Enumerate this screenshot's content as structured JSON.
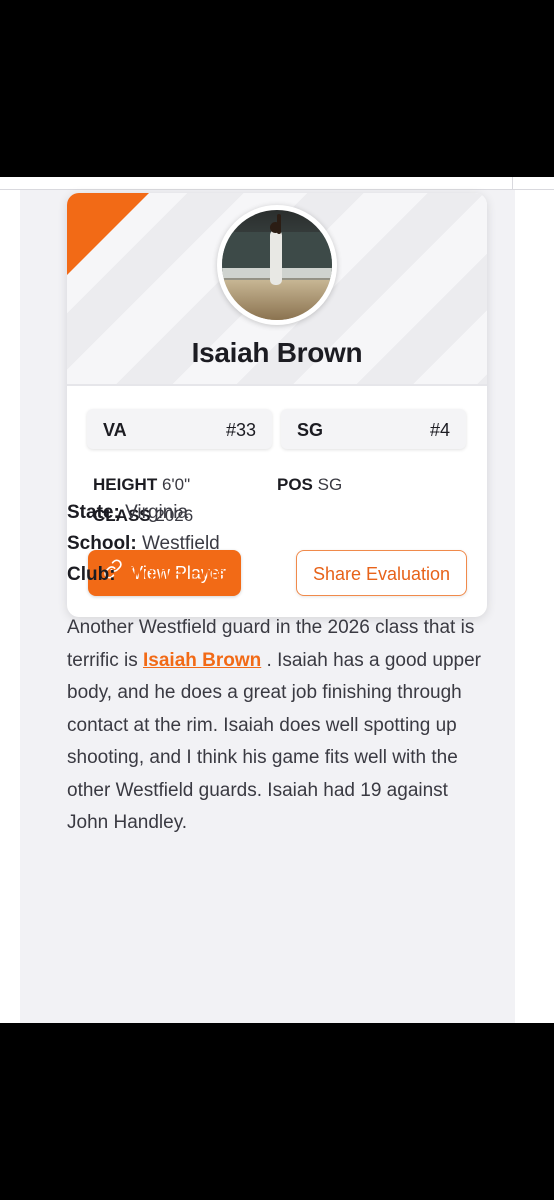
{
  "card": {
    "player_name": "Isaiah Brown",
    "chips": [
      {
        "left": "VA",
        "right": "#33"
      },
      {
        "left": "SG",
        "right": "#4"
      }
    ],
    "stats": {
      "height_label": "HEIGHT",
      "height_value": "6'0\"",
      "pos_label": "POS",
      "pos_value": "SG",
      "class_label": "CLASS",
      "class_value": "2026"
    },
    "view_player_label": "View Player",
    "share_label": "Share Evaluation"
  },
  "details": {
    "state_label": "State:",
    "state_value": "Virginia",
    "school_label": "School:",
    "school_value": "Westfield",
    "club_label": "Club:",
    "club_value": "Virginia Elite"
  },
  "article": {
    "text_before": "Another Westfield guard in the 2026 class that is terrific is ",
    "link_text": "Isaiah Brown",
    "text_after": " . Isaiah has a good upper body, and he does a great job finishing through contact at the rim. Isaiah does well spotting up shooting, and I think his game fits well with the other Westfield guards. Isaiah had 19 against John Handley."
  },
  "colors": {
    "accent": "#f26a16",
    "background": "#f2f2f5",
    "card": "#ffffff",
    "text": "#1c1c22"
  },
  "icons": {
    "view_player": "link-icon"
  }
}
